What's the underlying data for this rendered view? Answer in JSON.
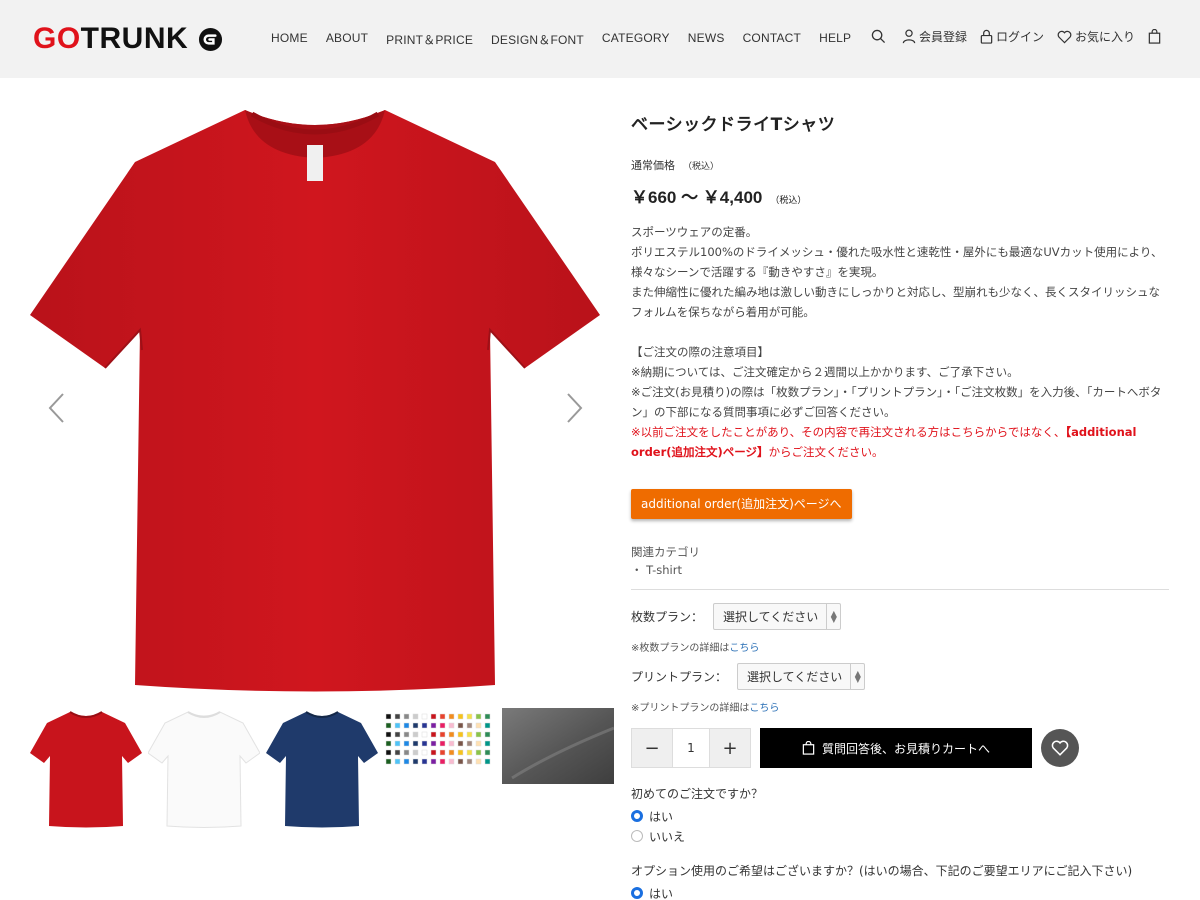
{
  "header": {
    "logo_text_red": "GO",
    "logo_text_dark": "TRUNK",
    "nav": [
      "HOME",
      "ABOUT",
      "PRINT＆PRICE",
      "DESIGN＆FONT",
      "CATEGORY",
      "NEWS",
      "CONTACT",
      "HELP"
    ],
    "register_label": "会員登録",
    "login_label": "ログイン",
    "favorites_label": "お気に入り"
  },
  "product": {
    "title": "ベーシックドライTシャツ",
    "price_label": "通常価格",
    "tax_label": "（税込）",
    "price_range": "￥660 〜 ￥4,400",
    "price_tax": "（税込）",
    "description": [
      "スポーツウェアの定番。",
      "ポリエステル100%のドライメッシュ・優れた吸水性と速乾性・屋外にも最適なUVカット使用により、様々なシーンで活躍する『動きやすさ』を実現。",
      "また伸縮性に優れた編み地は激しい動きにしっかりと対応し、型崩れも少なく、長くスタイリッシュなフォルムを保ちながら着用が可能。"
    ],
    "notice_title": "【ご注文の際の注意項目】",
    "notice_1": "※納期については、ご注文確定から２週間以上かかります、ご了承下さい。",
    "notice_2": "※ご注文(お見積り)の際は「枚数プラン」・「プリントプラン」・「ご注文枚数」を入力後、「カートへボタン」の下部になる質問事項に必ずご回答ください。",
    "notice_red_a": "※以前ご注文をしたことがあり、その内容で再注文される方はこちらからではなく、",
    "notice_red_b": "【additional order(追加注文)ページ】",
    "notice_red_c": "からご注文ください。",
    "additional_button": "additional order(追加注文)ページへ",
    "related_label": "関連カテゴリ",
    "related_item": "・ T-shirt"
  },
  "options": {
    "quantity_plan_label": "枚数プラン：",
    "quantity_plan_value": "選択してください",
    "quantity_note": "※枚数プランの詳細は",
    "quantity_note_link": "こちら",
    "print_plan_label": "プリントプラン：",
    "print_plan_value": "選択してください",
    "print_note": "※プリントプランの詳細は",
    "print_note_link": "こちら"
  },
  "cart": {
    "minus": "−",
    "quantity": "1",
    "plus": "+",
    "button_label": "質問回答後、お見積りカートへ"
  },
  "questions": {
    "q1": "初めてのご注文ですか？",
    "q1_yes": "はい",
    "q1_no": "いいえ",
    "q1_selected": "yes",
    "q2": "オプション使用のご希望はございますか？(はいの場合、下記のご要望エリアにご記入下さい)",
    "q2_yes": "はい",
    "q2_selected": "yes"
  },
  "colors": {
    "accent_red": "#e0121b",
    "button_orange": "#ef6c00",
    "shirt_red": "#c8141c",
    "shirt_navy": "#1f3a6b",
    "radio_blue": "#1a6fe0"
  },
  "icons": [
    "search-icon",
    "user-icon",
    "lock-icon",
    "heart-icon",
    "bag-icon",
    "chevron-left-icon",
    "chevron-right-icon",
    "cart-icon"
  ]
}
